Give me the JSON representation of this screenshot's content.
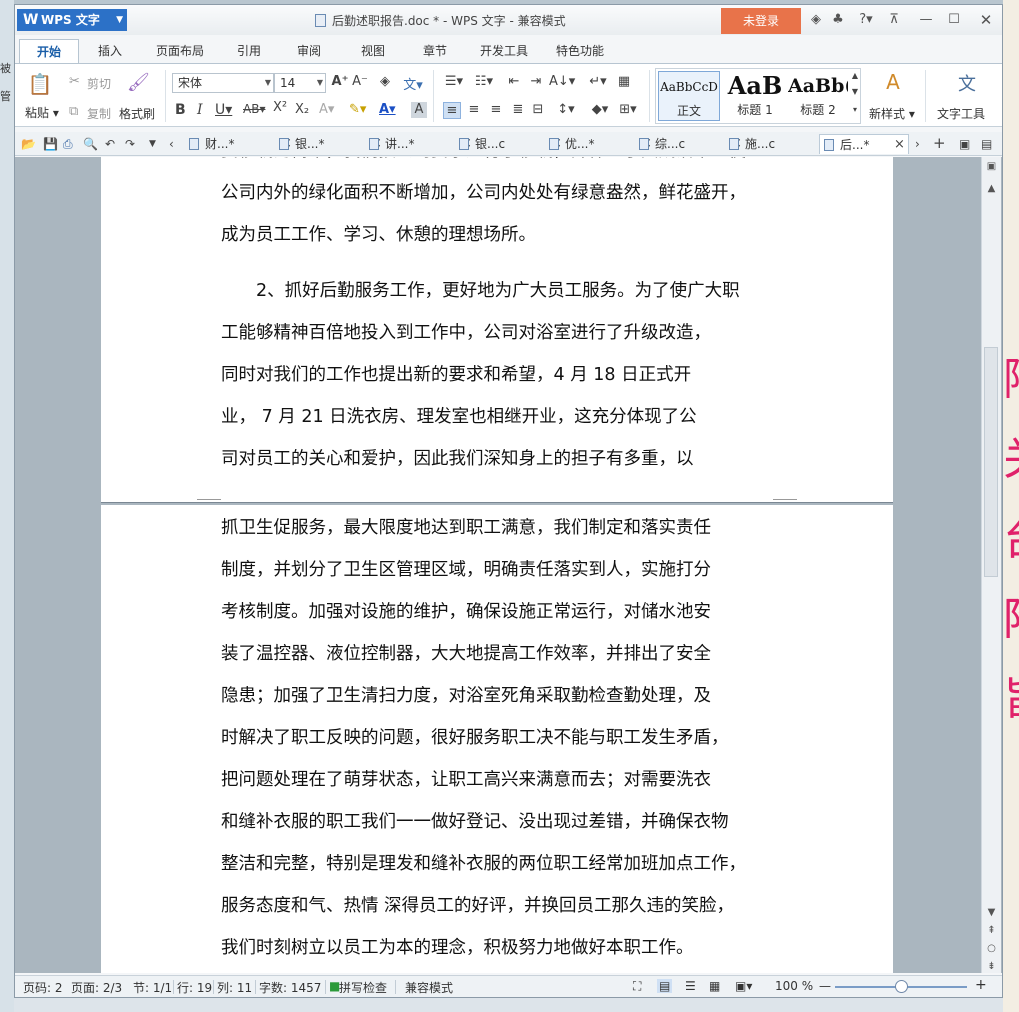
{
  "app": {
    "logo_label": "WPS 文字",
    "title": "后勤述职报告.doc * - WPS 文字 - 兼容模式",
    "login_label": "未登录"
  },
  "ribbon_tabs": [
    "开始",
    "插入",
    "页面布局",
    "引用",
    "审阅",
    "视图",
    "章节",
    "开发工具",
    "特色功能"
  ],
  "ribbon": {
    "paste": "粘贴",
    "cut": "剪切",
    "copy": "复制",
    "format_painter": "格式刷",
    "font_name": "宋体",
    "font_size": "14",
    "styles": [
      {
        "sample": "AaBbCcD",
        "name": "正文"
      },
      {
        "sample": "AaB",
        "name": "标题 1"
      },
      {
        "sample": "AaBb(",
        "name": "标题 2"
      }
    ],
    "new_style": "新样式",
    "text_tools": "文字工具"
  },
  "doc_tabs": [
    "财...*",
    "银...*",
    "讲...*",
    "银...c",
    "优...*",
    "综...c",
    "施...c",
    "后...*"
  ],
  "document": {
    "page1_lines": [
      "要移栽的树木，我们按公司要求进行了移栽，并保证了其成活率。使",
      "公司内外的绿化面积不断增加，公司内处处有绿意盎然，鲜花盛开，",
      "成为员工工作、学习、休憩的理想场所。",
      "　　2、抓好后勤服务工作，更好地为广大员工服务。为了使广大职",
      "工能够精神百倍地投入到工作中，公司对浴室进行了升级改造，",
      "同时对我们的工作也提出新的要求和希望，4 月 18 日正式开",
      "业，  7 月 21 日洗衣房、理发室也相继开业，这充分体现了公",
      "司对员工的关心和爱护，因此我们深知身上的担子有多重，以"
    ],
    "page2_lines": [
      "抓卫生促服务，最大限度地达到职工满意，我们制定和落实责任",
      "制度，并划分了卫生区管理区域，明确责任落实到人，实施打分",
      "考核制度。加强对设施的维护，确保设施正常运行，对储水池安",
      "装了温控器、液位控制器，大大地提高工作效率，并排出了安全",
      "隐患；加强了卫生清扫力度，对浴室死角采取勤检查勤处理，及",
      "时解决了职工反映的问题，很好服务职工决不能与职工发生矛盾，",
      "把问题处理在了萌芽状态，让职工高兴来满意而去；对需要洗衣",
      "和缝补衣服的职工我们一一做好登记、没出现过差错，并确保衣物",
      "整洁和完整，特别是理发和缝补衣服的两位职工经常加班加点工作，",
      "服务态度和气、热情 深得员工的好评，并换回员工那久违的笑脸，",
      "我们时刻树立以员工为本的理念，积极努力地做好本职工作。"
    ]
  },
  "status": {
    "page_code": "页码: 2",
    "pages": "页面: 2/3",
    "section": "节: 1/1",
    "row": "行: 19",
    "col": "列: 11",
    "word_count": "字数: 1457",
    "spell_check": "拼写检查",
    "compat_mode": "兼容模式",
    "zoom": "100 %"
  },
  "zoom_fraction": 0.5
}
